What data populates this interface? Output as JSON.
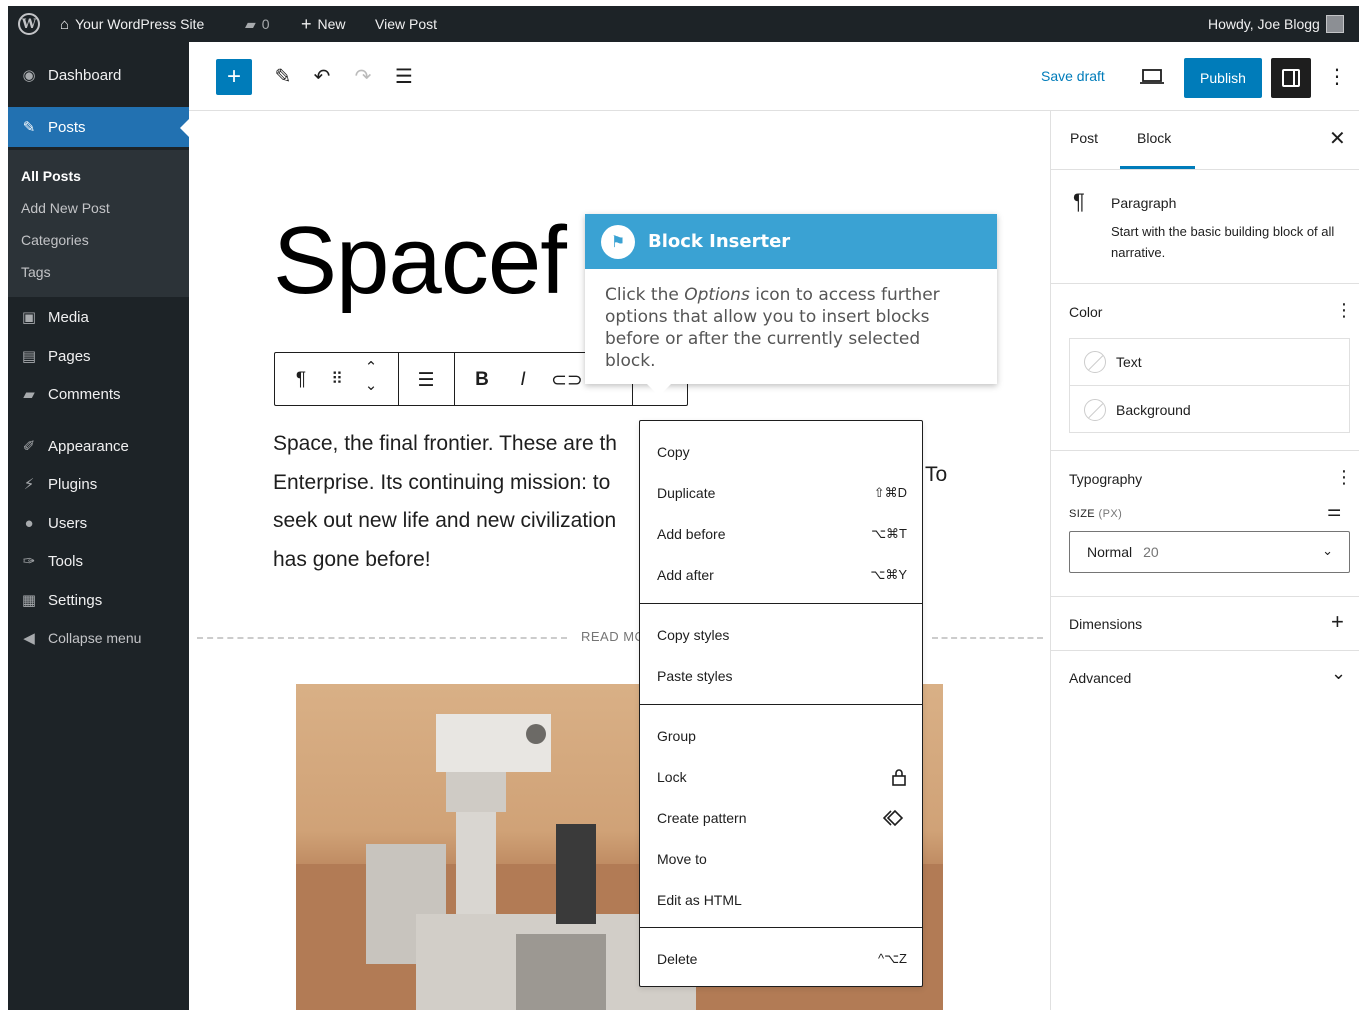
{
  "admin_bar": {
    "site_name": "Your WordPress Site",
    "comment_count": "0",
    "new_label": "New",
    "view_post_label": "View Post",
    "greeting": "Howdy, Joe Blogg"
  },
  "sidebar": {
    "items": [
      {
        "label": "Dashboard",
        "icon": "dashboard-icon"
      },
      {
        "label": "Posts",
        "icon": "pin-icon"
      },
      {
        "label": "Media",
        "icon": "media-icon"
      },
      {
        "label": "Pages",
        "icon": "pages-icon"
      },
      {
        "label": "Comments",
        "icon": "comment-icon"
      },
      {
        "label": "Appearance",
        "icon": "brush-icon"
      },
      {
        "label": "Plugins",
        "icon": "plug-icon"
      },
      {
        "label": "Users",
        "icon": "user-icon"
      },
      {
        "label": "Tools",
        "icon": "wrench-icon"
      },
      {
        "label": "Settings",
        "icon": "settings-icon"
      },
      {
        "label": "Collapse menu",
        "icon": "collapse-icon"
      }
    ],
    "submenu": [
      "All Posts",
      "Add New Post",
      "Categories",
      "Tags"
    ],
    "active_color": "#2271b1"
  },
  "toolbar": {
    "save_draft": "Save draft",
    "publish": "Publish",
    "accent": "#007cba"
  },
  "editor": {
    "title": "Spacef",
    "paragraph_lines": [
      "Space, the final frontier. These are th",
      "Enterprise. Its continuing mission: to",
      "seek out new life and new civilization",
      "has gone before!"
    ],
    "paragraph_right_fragment": "To",
    "readmore": "READ MC"
  },
  "guide": {
    "title": "Block Inserter",
    "body_before": "Click the ",
    "body_em": "Options",
    "body_after": " icon to access further options that allow you to insert blocks before or after the currently selected block."
  },
  "options_menu": {
    "groups": [
      [
        {
          "label": "Copy",
          "shortcut": ""
        },
        {
          "label": "Duplicate",
          "shortcut": "⇧⌘D"
        },
        {
          "label": "Add before",
          "shortcut": "⌥⌘T"
        },
        {
          "label": "Add after",
          "shortcut": "⌥⌘Y"
        }
      ],
      [
        {
          "label": "Copy styles",
          "shortcut": ""
        },
        {
          "label": "Paste styles",
          "shortcut": ""
        }
      ],
      [
        {
          "label": "Group",
          "shortcut": ""
        },
        {
          "label": "Lock",
          "shortcut": "",
          "icon": "lock-icon"
        },
        {
          "label": "Create pattern",
          "shortcut": "",
          "icon": "pattern-icon"
        },
        {
          "label": "Move to",
          "shortcut": ""
        },
        {
          "label": "Edit as HTML",
          "shortcut": ""
        }
      ],
      [
        {
          "label": "Delete",
          "shortcut": "^⌥Z"
        }
      ]
    ]
  },
  "inspector": {
    "tabs": [
      "Post",
      "Block"
    ],
    "active_tab": "Block",
    "block_name": "Paragraph",
    "block_desc": "Start with the basic building block of all narrative.",
    "color_title": "Color",
    "color_text": "Text",
    "color_background": "Background",
    "typography_title": "Typography",
    "size_label": "SIZE",
    "size_unit": "(PX)",
    "size_value": "Normal",
    "size_number": "20",
    "dimensions_title": "Dimensions",
    "advanced_title": "Advanced"
  }
}
